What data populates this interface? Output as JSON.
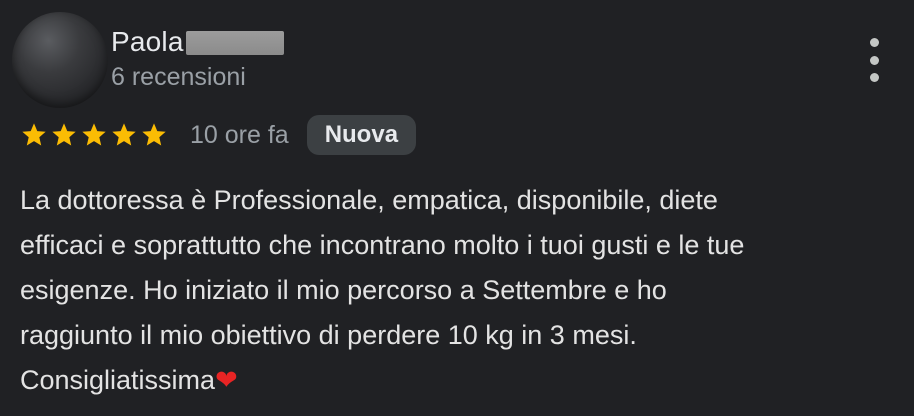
{
  "review": {
    "author_name": "Paola",
    "reviews_count": "6 recensioni",
    "rating": 5,
    "stars": [
      1,
      1,
      1,
      1,
      1
    ],
    "time_ago": "10 ore fa",
    "badge": "Nuova",
    "text_lines": [
      "La dottoressa è Professionale, empatica, disponibile, diete",
      "efficaci e soprattutto che incontrano molto i tuoi gusti e le tue",
      "esigenze. Ho iniziato il mio percorso a Settembre e ho",
      "raggiunto il mio obiettivo di perdere 10 kg in 3 mesi.",
      "Consigliatissima"
    ],
    "emoji": "❤",
    "icons": {
      "menu": "more-vert-icon",
      "star": "star-icon",
      "heart": "heart-icon"
    },
    "colors": {
      "background": "#202124",
      "star": "#fbbc04",
      "heart": "#e82424",
      "badge_bg": "#3c4043"
    }
  }
}
